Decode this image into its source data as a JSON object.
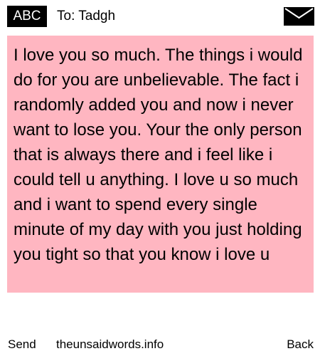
{
  "header": {
    "mode_badge": "ABC",
    "recipient": "To: Tadgh",
    "envelope_icon": "envelope-icon"
  },
  "message": {
    "text": "I love you so much. The things i would do for you are unbelievable. The fact i randomly added you and now i never want to lose you. Your the only person that is always there and i feel like i could tell u anything. I love u so much and i want to spend every single minute of my day with you just holding you tight so that you know i love u",
    "background_color": "#ffb6c1"
  },
  "footer": {
    "send_label": "Send",
    "site_label": "theunsaidwords.info",
    "back_label": "Back"
  }
}
